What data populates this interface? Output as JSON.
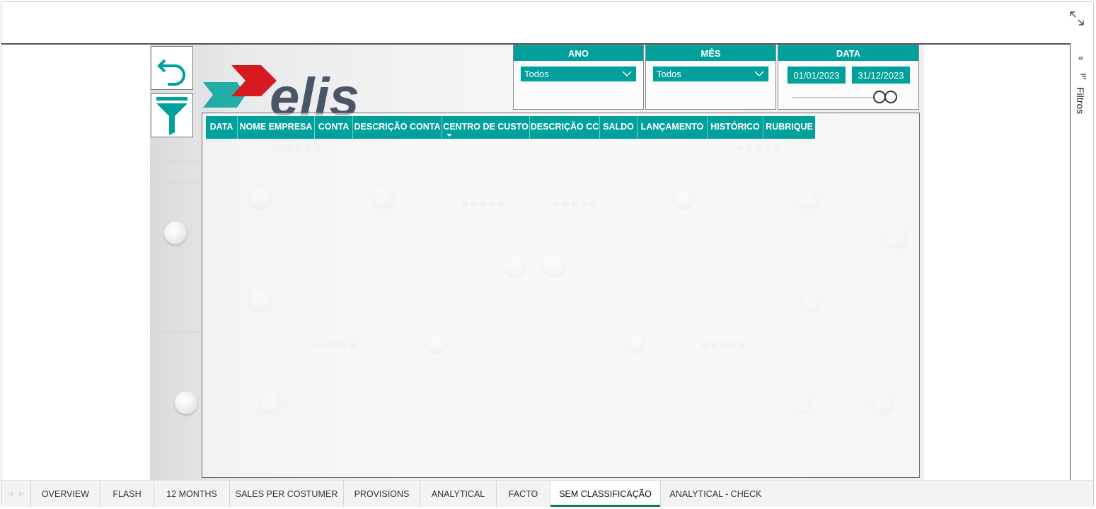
{
  "sidebar": {
    "filters_label": "Filtros"
  },
  "slicers": {
    "ano": {
      "title": "ANO",
      "value": "Todos"
    },
    "mes": {
      "title": "MÊS",
      "value": "Todos"
    },
    "data": {
      "title": "DATA",
      "start": "01/01/2023",
      "end": "31/12/2023"
    }
  },
  "logo": {
    "text": "elis"
  },
  "table": {
    "columns": [
      "DATA",
      "NOME EMPRESA",
      "CONTA",
      "DESCRIÇÃO CONTA",
      "CENTRO DE CUSTO",
      "DESCRIÇÃO CC",
      "SALDO",
      "LANÇAMENTO",
      "HISTÓRICO",
      "RUBRIQUE"
    ]
  },
  "tabs": [
    "OVERVIEW",
    "FLASH",
    "12 MONTHS",
    "SALES PER COSTUMER",
    "PROVISIONS",
    "ANALYTICAL",
    "FACTO",
    "SEM CLASSIFICAÇÃO",
    "ANALYTICAL - CHECK"
  ],
  "active_tab": "SEM CLASSIFICAÇÃO",
  "colors": {
    "accent": "#00a19c",
    "active_tab_underline": "#117865",
    "logo_red": "#d71920",
    "logo_grey": "#4a5566"
  }
}
